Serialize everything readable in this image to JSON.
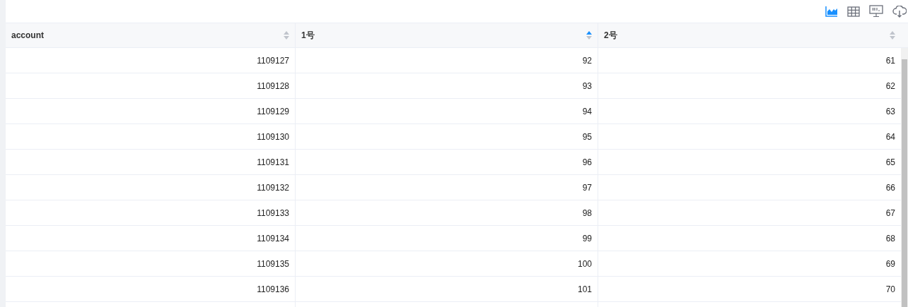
{
  "toolbar": [
    {
      "kind": "chart",
      "selected": true
    },
    {
      "kind": "table",
      "selected": false
    },
    {
      "kind": "sql",
      "selected": false
    },
    {
      "kind": "download",
      "selected": false
    }
  ],
  "table": {
    "columns": [
      {
        "label": "account",
        "sorted": false
      },
      {
        "label": "1号",
        "sorted": true
      },
      {
        "label": "2号",
        "sorted": false
      }
    ],
    "rows": [
      [
        "1109127",
        "92",
        "61"
      ],
      [
        "1109128",
        "93",
        "62"
      ],
      [
        "1109129",
        "94",
        "63"
      ],
      [
        "1109130",
        "95",
        "64"
      ],
      [
        "1109131",
        "96",
        "65"
      ],
      [
        "1109132",
        "97",
        "66"
      ],
      [
        "1109133",
        "98",
        "67"
      ],
      [
        "1109134",
        "99",
        "68"
      ],
      [
        "1109135",
        "100",
        "69"
      ],
      [
        "1109136",
        "101",
        "70"
      ]
    ]
  }
}
